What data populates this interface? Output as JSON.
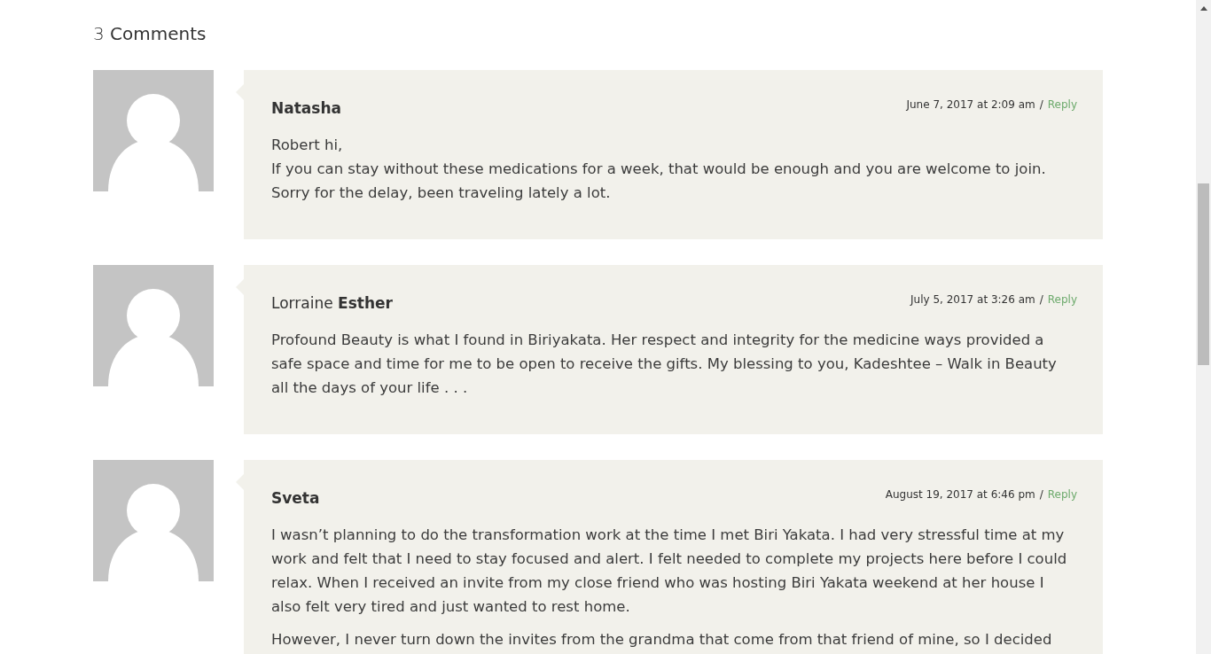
{
  "heading": "3 **Comments**",
  "comments": [
    {
      "author": "Natasha",
      "author_bold": true,
      "date": "June 7, 2017 at 2:09 am",
      "separator": "/",
      "reply": "Reply",
      "paragraphs": [
        "Robert hi,\nIf you can stay without these medications for a week, that would be enough and you are welcome to join. Sorry for the delay, been traveling lately a lot."
      ]
    },
    {
      "author": "Lorraine **Esther**",
      "author_bold": false,
      "date": "July 5, 2017 at 3:26 am",
      "separator": "/",
      "reply": "Reply",
      "paragraphs": [
        "Profound Beauty is what I found in Biriyakata. Her respect and integrity for the medicine ways provided a safe space and time for me to be open to receive the gifts. My blessing to you, Kadeshtee – Walk in Beauty all the days of your life . . ."
      ]
    },
    {
      "author": "Sveta",
      "author_bold": true,
      "date": "August 19, 2017 at 6:46 pm",
      "separator": "/",
      "reply": "Reply",
      "paragraphs": [
        "I wasn’t planning to do the transformation work at the time I met Biri Yakata. I had very stressful time at my work and felt that I need to stay focused and alert. I felt needed to complete my projects here before I could relax. When I received an invite from my close friend who was hosting Biri Yakata weekend at her house I also felt very tired and just wanted to rest home.",
        "However, I never turn down the invites from the grandma that come from that friend of mine, so I decided"
      ]
    }
  ]
}
